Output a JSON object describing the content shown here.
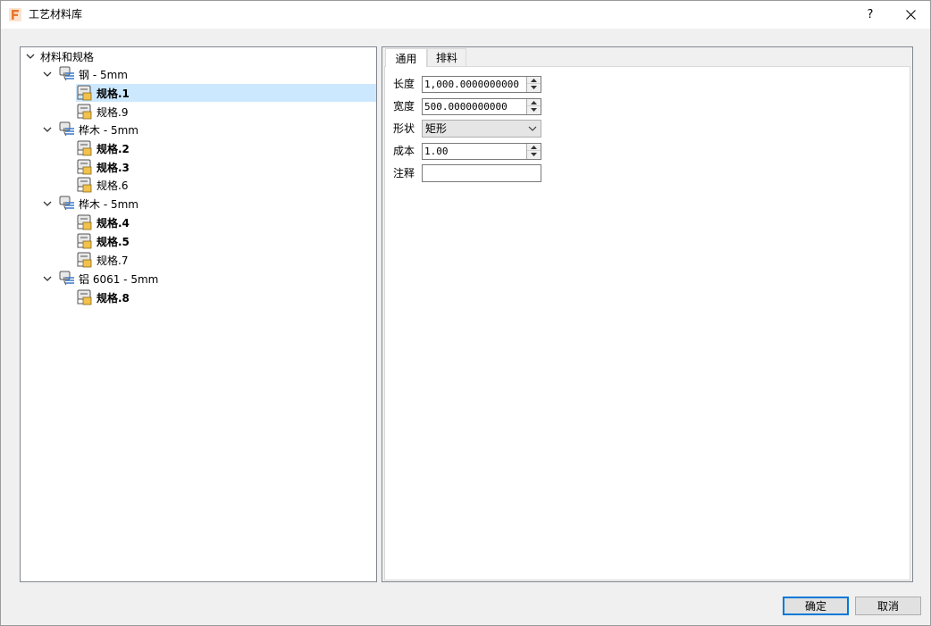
{
  "window": {
    "title": "工艺材料库",
    "help_label": "?"
  },
  "tree": {
    "root": "材料和规格",
    "materials": [
      {
        "label": "钢 - 5mm",
        "specs": [
          {
            "label": "规格.1",
            "bold": true,
            "selected": true
          },
          {
            "label": "规格.9",
            "bold": false,
            "selected": false
          }
        ]
      },
      {
        "label": "桦木 - 5mm",
        "specs": [
          {
            "label": "规格.2",
            "bold": true,
            "selected": false
          },
          {
            "label": "规格.3",
            "bold": true,
            "selected": false
          },
          {
            "label": "规格.6",
            "bold": false,
            "selected": false
          }
        ]
      },
      {
        "label": "桦木 - 5mm",
        "specs": [
          {
            "label": "规格.4",
            "bold": true,
            "selected": false
          },
          {
            "label": "规格.5",
            "bold": true,
            "selected": false
          },
          {
            "label": "规格.7",
            "bold": false,
            "selected": false
          }
        ]
      },
      {
        "label": "铝 6061 - 5mm",
        "specs": [
          {
            "label": "规格.8",
            "bold": true,
            "selected": false
          }
        ]
      }
    ]
  },
  "tabs": [
    {
      "label": "通用",
      "active": true
    },
    {
      "label": "排料",
      "active": false
    }
  ],
  "form": {
    "length_label": "长度",
    "length_value": "1,000.0000000000",
    "width_label": "宽度",
    "width_value": "500.0000000000",
    "shape_label": "形状",
    "shape_value": "矩形",
    "cost_label": "成本",
    "cost_value": "1.00",
    "note_label": "注释",
    "note_value": ""
  },
  "buttons": {
    "ok_label": "确定",
    "cancel_label": "取消"
  },
  "colors": {
    "app_icon": "#e8772e",
    "selection": "#cce8ff",
    "primary_border": "#0078d7",
    "spec_icon_accent": "#f2c14e",
    "material_icon_accent": "#3a78c9"
  }
}
